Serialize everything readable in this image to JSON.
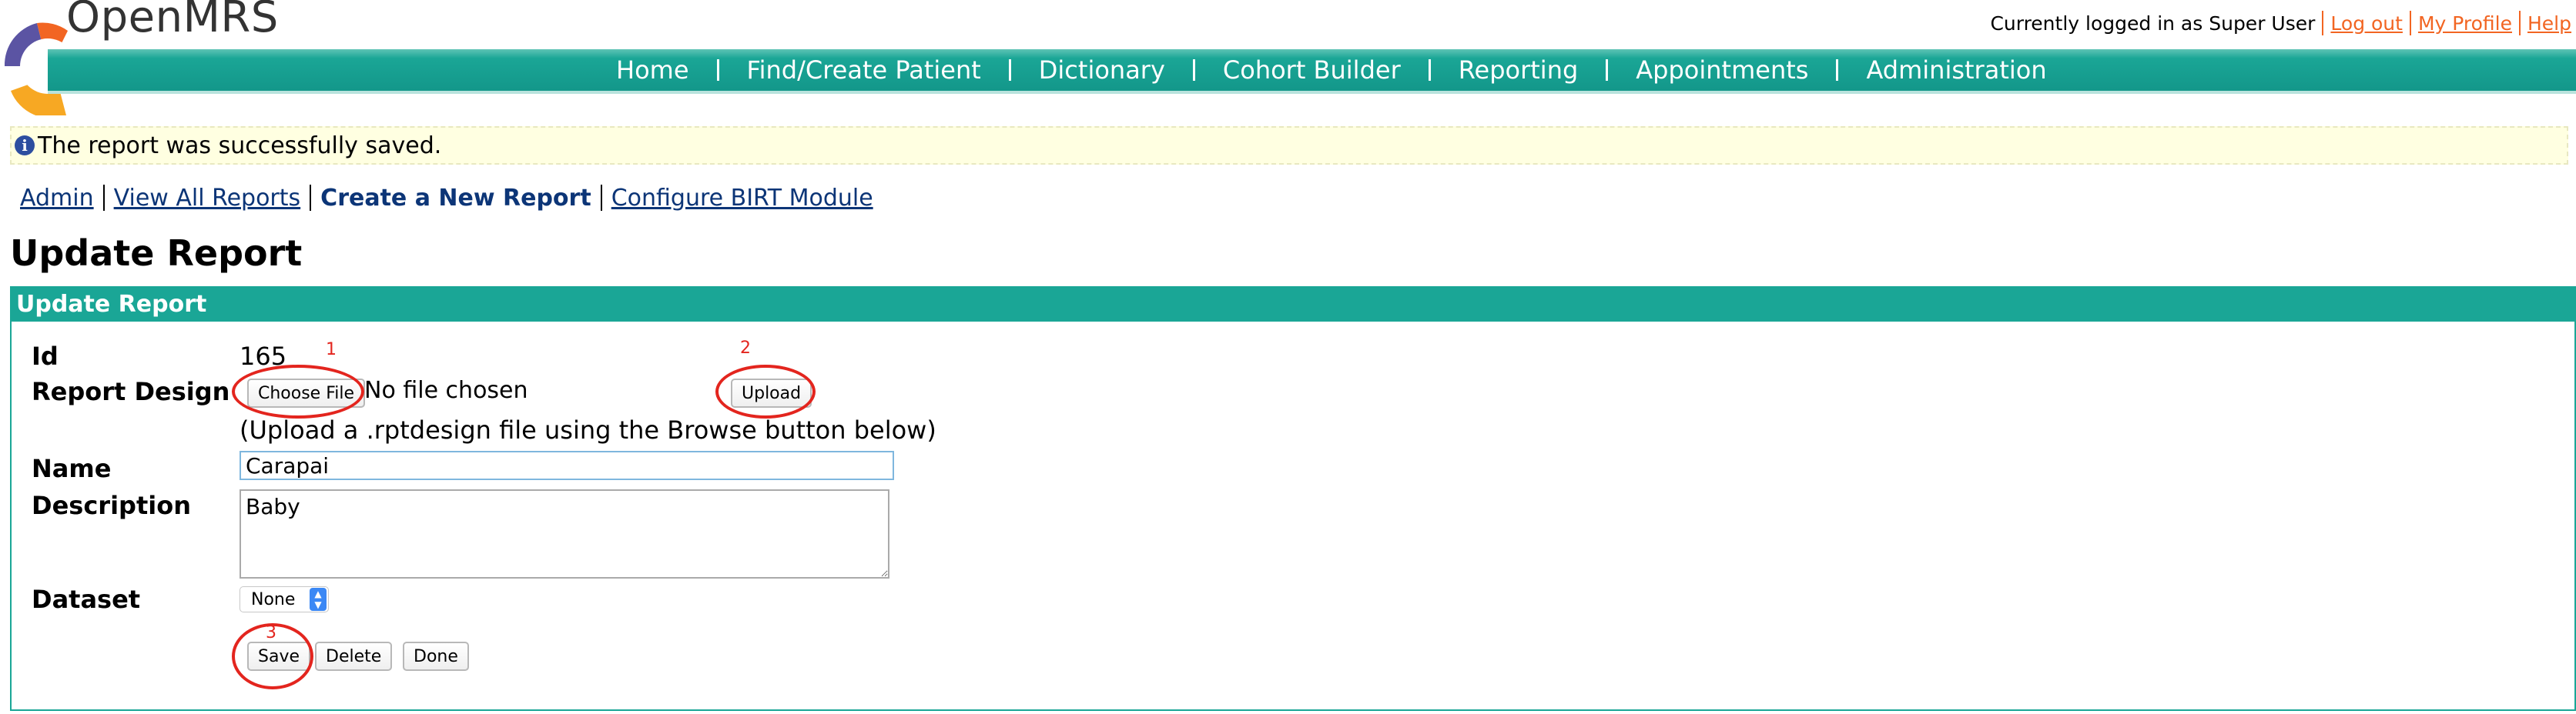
{
  "header": {
    "brand": "OpenMRS",
    "logged_in_text": "Currently logged in as Super User",
    "links": {
      "logout": "Log out",
      "profile": "My Profile",
      "help": "Help"
    }
  },
  "nav": {
    "items": [
      "Home",
      "Find/Create Patient",
      "Dictionary",
      "Cohort Builder",
      "Reporting",
      "Appointments",
      "Administration"
    ]
  },
  "alert": {
    "message": "The report was successfully saved."
  },
  "subnav": {
    "admin": "Admin",
    "view_all": "View All Reports",
    "create_new": "Create a New Report",
    "configure": "Configure BIRT Module"
  },
  "page": {
    "title": "Update Report"
  },
  "panel": {
    "header": "Update Report",
    "labels": {
      "id": "Id",
      "report_design": "Report Design",
      "name": "Name",
      "description": "Description",
      "dataset": "Dataset"
    },
    "id_value": "165",
    "file": {
      "choose_label": "Choose File",
      "no_file_text": "No file chosen",
      "upload_label": "Upload",
      "hint": "(Upload a .rptdesign file using the Browse button below)"
    },
    "name_value": "Carapai",
    "description_value": "Baby",
    "dataset_value": "None",
    "buttons": {
      "save": "Save",
      "delete": "Delete",
      "done": "Done"
    }
  },
  "annotations": {
    "n1": "1",
    "n2": "2",
    "n3": "3"
  },
  "colors": {
    "accent": "#1aa696",
    "link_orange": "#f26522",
    "link_blue": "#0c3577",
    "alert_bg": "#ffffe1",
    "annotation_red": "#e3251e"
  }
}
